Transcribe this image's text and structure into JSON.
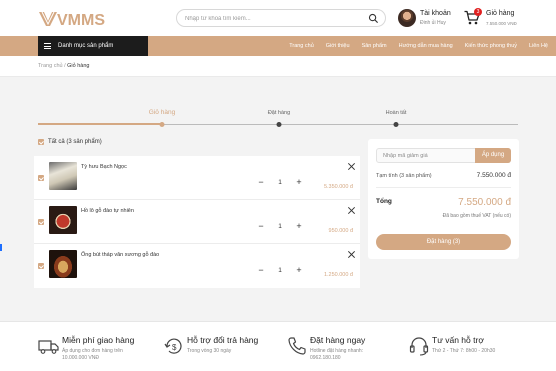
{
  "colors": {
    "accent": "#d4a883",
    "dark": "#1c1c1c",
    "badge": "#e02020",
    "background": "#f3f3f3"
  },
  "header": {
    "logo_text": "VMMS",
    "search": {
      "placeholder": "Nhập từ khoá tìm kiếm...",
      "icon": "search-icon"
    },
    "account": {
      "title": "Tài khoản",
      "name": "Đinh ủi Huy"
    },
    "cart": {
      "title": "Giỏ hàng",
      "amount": "7.550.000 VNĐ",
      "count": "3"
    }
  },
  "nav": {
    "category_label": "Danh mục sản phẩm",
    "links": [
      "Trang chủ",
      "Giới thiệu",
      "Sản phẩm",
      "Hướng dẫn mua hàng",
      "Kiến thức phong thuỷ",
      "Liên Hệ"
    ]
  },
  "breadcrumb": {
    "home": "Trang chủ",
    "separator": "/",
    "current": "Giỏ hàng"
  },
  "steps": [
    {
      "label": "Giỏ hàng",
      "active": true
    },
    {
      "label": "Đặt hàng",
      "active": false
    },
    {
      "label": "Hoàn tất",
      "active": false
    }
  ],
  "cart": {
    "select_all_label": "Tất cả (3 sản phẩm)",
    "items": [
      {
        "name": "Tỳ hưu Bạch Ngọc",
        "quantity": "1",
        "price": "5.350.000 đ",
        "minus": "−",
        "plus": "+"
      },
      {
        "name": "Hồ lô gỗ đào tự nhiên",
        "quantity": "1",
        "price": "950.000 đ",
        "minus": "−",
        "plus": "+"
      },
      {
        "name": "Ống bút tháp văn xương gỗ đào",
        "quantity": "1",
        "price": "1.250.000 đ",
        "minus": "−",
        "plus": "+"
      }
    ]
  },
  "summary": {
    "coupon_placeholder": "Nhập mã giảm giá",
    "apply_label": "Áp dụng",
    "subtotal_label": "Tạm tính (3 sản phẩm)",
    "subtotal_value": "7.550.000 đ",
    "total_label": "Tổng",
    "total_value": "7.550.000 đ",
    "vat_note": "Đã bao gồm thuế VAT (nếu có)",
    "checkout_label": "Đặt hàng (3)"
  },
  "features": [
    {
      "icon": "truck-icon",
      "title": "Miễn phí giao hàng",
      "line1": "Áp dụng cho đơn hàng trên",
      "line2": "10.000.000 VNĐ"
    },
    {
      "icon": "money-return-icon",
      "title": "Hỗ trợ đổi trả hàng",
      "line1": "Trong vòng 30 ngày",
      "line2": ""
    },
    {
      "icon": "phone-icon",
      "title": "Đặt hàng ngay",
      "line1": "Hotline đặt hàng nhanh:",
      "line2": "0962.180.180"
    },
    {
      "icon": "headset-icon",
      "title": "Tư vấn hỗ trợ",
      "line1": "Thứ 2 - Thứ 7: 8h00 - 20h30",
      "line2": ""
    }
  ]
}
